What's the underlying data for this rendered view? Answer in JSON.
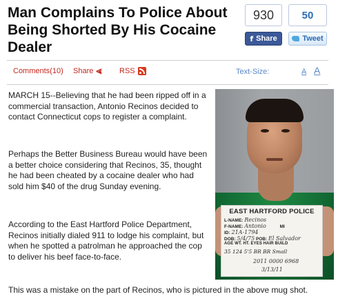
{
  "article": {
    "headline": "Man Complains To Police About Being Shorted By His Cocaine Dealer",
    "paragraphs": [
      "MARCH 15--Believing that he had been ripped off in a commercial transaction, Antonio Recinos decided to contact Connecticut cops to register a complaint.",
      "Perhaps the Better Business Bureau would have been a better choice considering that Recinos, 35, thought he had been cheated by a cocaine dealer who had sold him $40 of the drug Sunday evening.",
      "According to the East Hartford Police Department, Recinos initially dialed 911 to lodge his complaint, but when he spotted a patrolman he approached the cop to deliver his beef face-to-face."
    ],
    "last_line": "This was a mistake on the part of Recinos, who is pictured in the above mug shot."
  },
  "share": {
    "facebook_count": "930",
    "facebook_label": "Share",
    "twitter_count": "50",
    "twitter_label": "Tweet"
  },
  "toolbar": {
    "comments_label": "Comments(10)",
    "share_label": "Share",
    "rss_label": "RSS",
    "text_size_label": "Text-Size:",
    "text_small": "A",
    "text_large": "A"
  },
  "mugshot": {
    "sign_title": "EAST HARTFORD POLICE",
    "lname_label": "L-NAME:",
    "lname_value": "Recinos",
    "fname_label": "F-NAME:",
    "fname_value": "Antonio",
    "mi_label": "MI",
    "id_label": "ID:",
    "id_value": "21A-1794",
    "dob_label": "DOB:",
    "dob_value": "5/4/75",
    "pob_label": "POB:",
    "pob_value": "El Salvador",
    "grid_headers": "AGE  WT.  HT.  EYES  HAIR  BUILD",
    "grid_values": "35  124  5'5  BR  BR  Small",
    "case_number": "2011 0000 6968",
    "date": "3/13/11"
  },
  "colors": {
    "accent_red": "#c4271e",
    "link_blue": "#5a88c8",
    "facebook_blue": "#3b5998",
    "shirt_green": "#126a33"
  }
}
